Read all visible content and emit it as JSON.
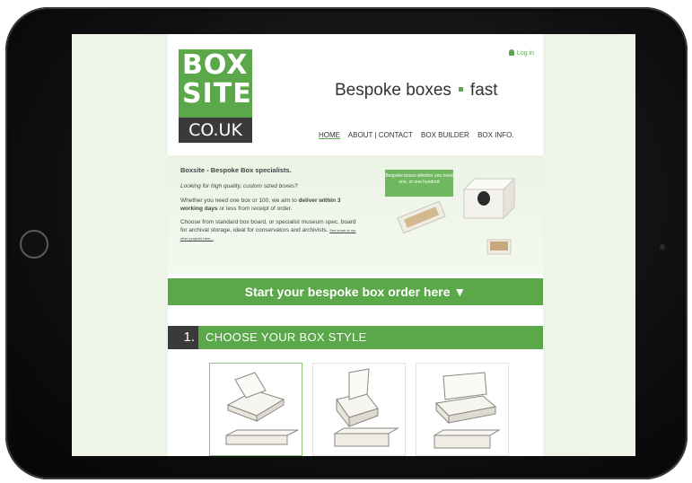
{
  "site": {
    "login": "Log in",
    "logo": {
      "line1": "BOX",
      "line2": "SITE",
      "line3": "CO.UK"
    },
    "tagline": {
      "part1": "Bespoke boxes",
      "part2": "fast"
    },
    "nav": [
      {
        "label": "HOME",
        "active": true
      },
      {
        "label": "ABOUT | CONTACT",
        "active": false
      },
      {
        "label": "BOX BUILDER",
        "active": false
      },
      {
        "label": "BOX INFO.",
        "active": false
      }
    ]
  },
  "hero": {
    "heading": "Boxsite - Bespoke Box specialists.",
    "subheading": "Looking for high quality, custom sized boxes?",
    "para1_a": "Whether you need one box or 100, we aim to ",
    "para1_b": "deliver within 3 working days",
    "para1_c": " or less from receipt of order.",
    "para2": "Choose from standard box board, or specialist museum spec. board for archival storage, ideal for conservators and archivists.",
    "para2_link": "See some of our other projects here...",
    "bubble": "Bespoke boxes whether you need one, or one hundred"
  },
  "cta": {
    "label": "Start your bespoke box order here",
    "icon": "triangle-down-icon"
  },
  "step1": {
    "number": "1.",
    "label": "CHOOSE YOUR BOX STYLE"
  },
  "box_styles": [
    {
      "name": "tray-with-lid",
      "selected": true
    },
    {
      "name": "folder-box",
      "selected": false
    },
    {
      "name": "hinged-lid-box",
      "selected": false
    }
  ],
  "colors": {
    "accent": "#5aa84a",
    "dark": "#3a3a3a",
    "background": "#eef5e8"
  }
}
